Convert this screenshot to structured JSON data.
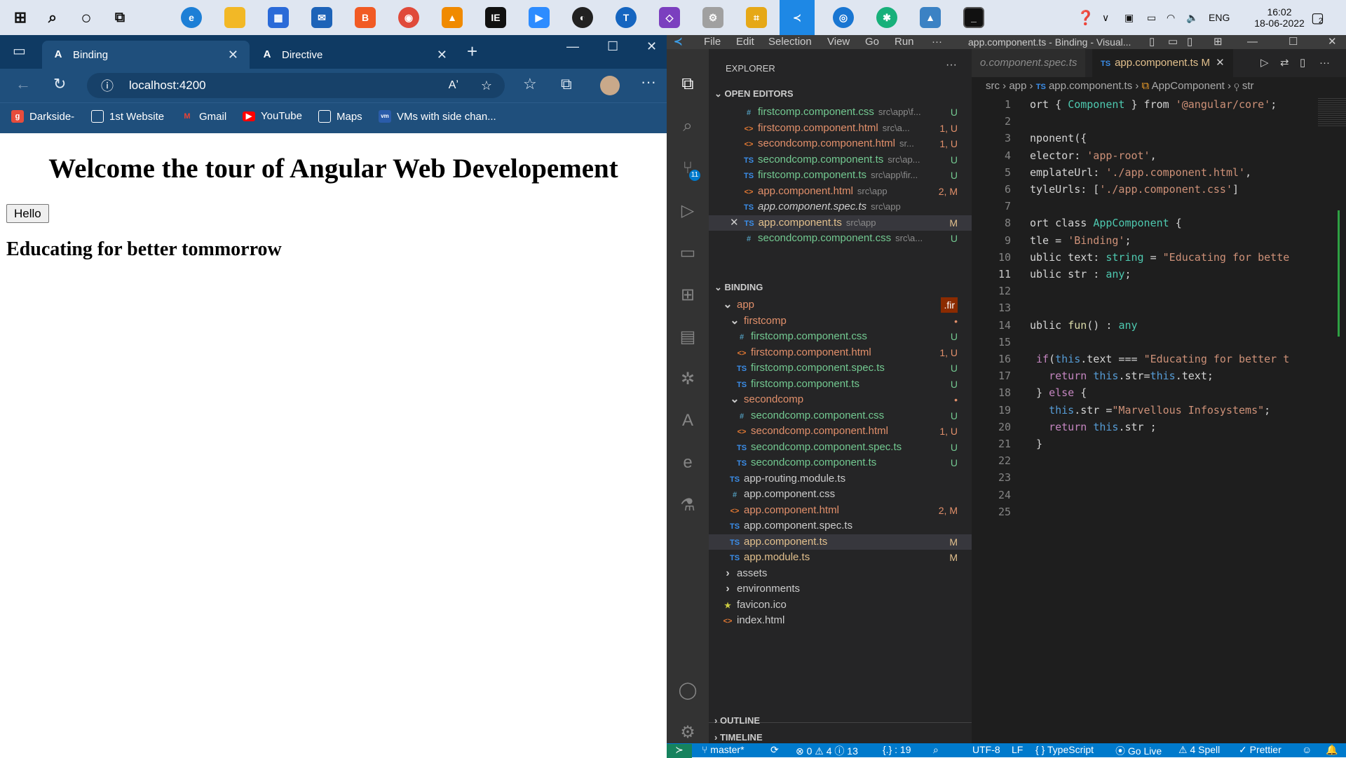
{
  "taskbar": {
    "tray_lang": "ENG",
    "time": "16:02",
    "date": "18-06-2022",
    "notif_count": "2"
  },
  "browser": {
    "tabs": [
      {
        "label": "Binding",
        "active": true
      },
      {
        "label": "Directive",
        "active": false
      }
    ],
    "url": "localhost:4200",
    "bookmarks": [
      "Darkside-",
      "1st Website",
      "Gmail",
      "YouTube",
      "Maps",
      "VMs with side chan..."
    ],
    "page": {
      "heading": "Welcome the tour of Angular Web Developement",
      "button_label": "Hello",
      "subheading": "Educating for better tommorrow"
    }
  },
  "vscode": {
    "menu": [
      "File",
      "Edit",
      "Selection",
      "View",
      "Go",
      "Run",
      "···"
    ],
    "window_title": "app.component.ts - Binding - Visual...",
    "explorer_title": "EXPLORER",
    "explorer_more": "···",
    "open_editors_label": "OPEN EDITORS",
    "open_editors": [
      {
        "icon": "#",
        "name": "firstcomp.component.css",
        "path": "src\\app\\f...",
        "status": "U",
        "color": "#73c991"
      },
      {
        "icon": "<>",
        "name": "firstcomp.component.html",
        "path": "src\\a...",
        "status": "1, U",
        "color": "#e2906b"
      },
      {
        "icon": "<>",
        "name": "secondcomp.component.html",
        "path": "sr...",
        "status": "1, U",
        "color": "#e2906b"
      },
      {
        "icon": "TS",
        "name": "secondcomp.component.ts",
        "path": "src\\ap...",
        "status": "U",
        "color": "#73c991"
      },
      {
        "icon": "TS",
        "name": "firstcomp.component.ts",
        "path": "src\\app\\fir...",
        "status": "U",
        "color": "#73c991"
      },
      {
        "icon": "<>",
        "name": "app.component.html",
        "path": "src\\app",
        "status": "2, M",
        "color": "#e2906b"
      },
      {
        "icon": "TS",
        "name": "app.component.spec.ts",
        "path": "src\\app",
        "status": "",
        "color": "#cccccc"
      },
      {
        "icon": "TS",
        "name": "app.component.ts",
        "path": "src\\app",
        "status": "M",
        "color": "#e2c08d"
      },
      {
        "icon": "#",
        "name": "secondcomp.component.css",
        "path": "src\\a...",
        "status": "U",
        "color": "#73c991"
      }
    ],
    "project_label": "BINDING",
    "tree": [
      {
        "indent": 1,
        "icon": "v",
        "name": "app",
        "status": ".fir",
        "color": "#e2906b"
      },
      {
        "indent": 2,
        "icon": "v",
        "name": "firstcomp",
        "status": "•",
        "color": "#e2906b"
      },
      {
        "indent": 3,
        "icon": "#",
        "name": "firstcomp.component.css",
        "status": "U",
        "color": "#73c991"
      },
      {
        "indent": 3,
        "icon": "<>",
        "name": "firstcomp.component.html",
        "status": "1, U",
        "color": "#e2906b"
      },
      {
        "indent": 3,
        "icon": "TS",
        "name": "firstcomp.component.spec.ts",
        "status": "U",
        "color": "#73c991"
      },
      {
        "indent": 3,
        "icon": "TS",
        "name": "firstcomp.component.ts",
        "status": "U",
        "color": "#73c991"
      },
      {
        "indent": 2,
        "icon": "v",
        "name": "secondcomp",
        "status": "•",
        "color": "#e2906b"
      },
      {
        "indent": 3,
        "icon": "#",
        "name": "secondcomp.component.css",
        "status": "U",
        "color": "#73c991"
      },
      {
        "indent": 3,
        "icon": "<>",
        "name": "secondcomp.component.html",
        "status": "1, U",
        "color": "#e2906b"
      },
      {
        "indent": 3,
        "icon": "TS",
        "name": "secondcomp.component.spec.ts",
        "status": "U",
        "color": "#73c991"
      },
      {
        "indent": 3,
        "icon": "TS",
        "name": "secondcomp.component.ts",
        "status": "U",
        "color": "#73c991"
      },
      {
        "indent": 2,
        "icon": "TS",
        "name": "app-routing.module.ts",
        "status": "",
        "color": "#cccccc"
      },
      {
        "indent": 2,
        "icon": "#",
        "name": "app.component.css",
        "status": "",
        "color": "#cccccc"
      },
      {
        "indent": 2,
        "icon": "<>",
        "name": "app.component.html",
        "status": "2, M",
        "color": "#e2906b"
      },
      {
        "indent": 2,
        "icon": "TS",
        "name": "app.component.spec.ts",
        "status": "",
        "color": "#cccccc"
      },
      {
        "indent": 2,
        "icon": "TS",
        "name": "app.component.ts",
        "status": "M",
        "color": "#e2c08d"
      },
      {
        "indent": 2,
        "icon": "TS",
        "name": "app.module.ts",
        "status": "M",
        "color": "#e2c08d"
      },
      {
        "indent": 1,
        "icon": ">",
        "name": "assets",
        "status": "",
        "color": "#cccccc"
      },
      {
        "indent": 1,
        "icon": ">",
        "name": "environments",
        "status": "",
        "color": "#cccccc"
      },
      {
        "indent": 1,
        "icon": "★",
        "name": "favicon.ico",
        "status": "",
        "color": "#cccccc"
      },
      {
        "indent": 1,
        "icon": "<>",
        "name": "index.html",
        "status": "",
        "color": "#cccccc"
      }
    ],
    "outline_label": "OUTLINE",
    "timeline_label": "TIMELINE",
    "editor_tabs": [
      {
        "label": "o.component.spec.ts",
        "active": false
      },
      {
        "label": "app.component.ts",
        "badge": "M",
        "active": true
      }
    ],
    "breadcrumb": [
      "src",
      "app",
      "app.component.ts",
      "AppComponent",
      "str"
    ],
    "code_lines": [
      {
        "n": "1",
        "t": "ort { Component } from '@angular/core';"
      },
      {
        "n": "2",
        "t": ""
      },
      {
        "n": "3",
        "t": "nponent({"
      },
      {
        "n": "4",
        "t": "elector: 'app-root',"
      },
      {
        "n": "5",
        "t": "emplateUrl: './app.component.html',"
      },
      {
        "n": "6",
        "t": "tyleUrls: ['./app.component.css']"
      },
      {
        "n": "7",
        "t": ""
      },
      {
        "n": "8",
        "t": "ort class AppComponent {"
      },
      {
        "n": "9",
        "t": "tle = 'Binding';"
      },
      {
        "n": "10",
        "t": "ublic text: string = \"Educating for bette"
      },
      {
        "n": "11",
        "t": "ublic str : any;"
      },
      {
        "n": "12",
        "t": ""
      },
      {
        "n": "13",
        "t": ""
      },
      {
        "n": "14",
        "t": "ublic fun() : any"
      },
      {
        "n": "15",
        "t": ""
      },
      {
        "n": "16",
        "t": " if(this.text === \"Educating for better t"
      },
      {
        "n": "17",
        "t": "   return this.str=this.text;"
      },
      {
        "n": "18",
        "t": " } else {"
      },
      {
        "n": "19",
        "t": "   this.str =\"Marvellous Infosystems\";"
      },
      {
        "n": "20",
        "t": "   return this.str ;"
      },
      {
        "n": "21",
        "t": " }"
      },
      {
        "n": "22",
        "t": ""
      },
      {
        "n": "23",
        "t": ""
      },
      {
        "n": "24",
        "t": ""
      },
      {
        "n": "25",
        "t": ""
      }
    ],
    "status": {
      "branch": "master*",
      "problems": "⊗ 0 ⚠ 4 ⓘ 13",
      "braces": "{.} : 19",
      "encoding": "UTF-8",
      "eol": "LF",
      "language": "{ } TypeScript",
      "golive": "Go Live",
      "spell": "⚠ 4 Spell",
      "prettier": "✓ Prettier"
    }
  }
}
